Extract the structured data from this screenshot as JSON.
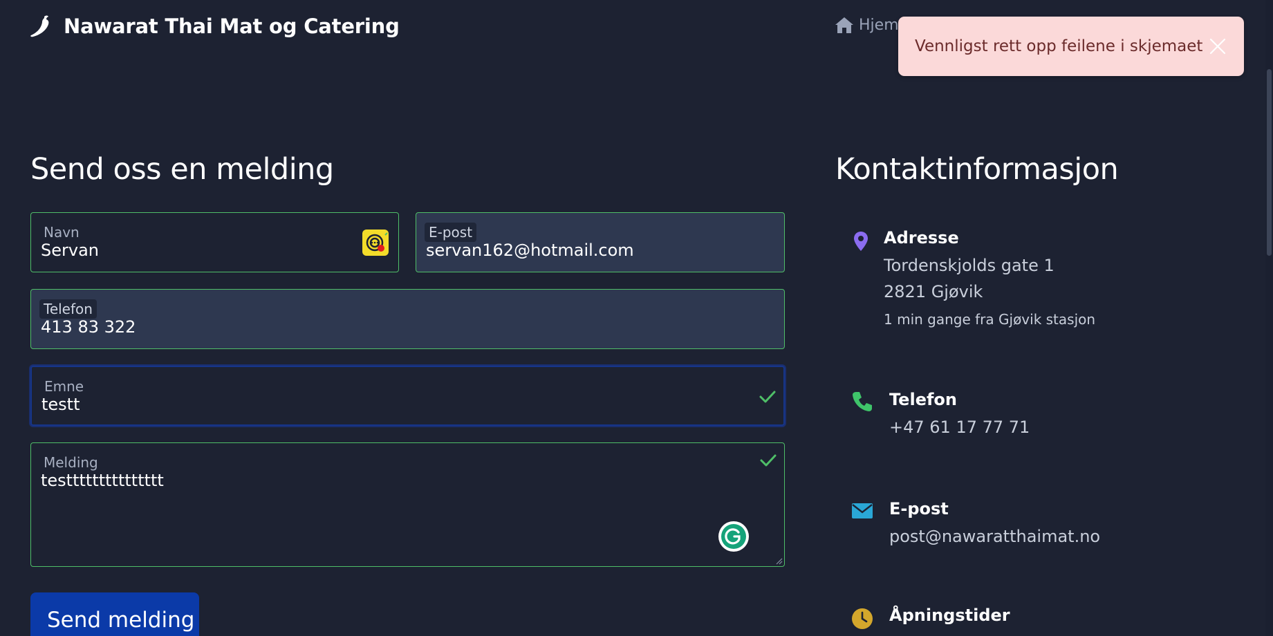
{
  "header": {
    "brand": "Nawarat Thai Mat og Catering",
    "nav_home": "Hjem"
  },
  "toast": {
    "message": "Vennligst rett opp feilene i skjemaet"
  },
  "form": {
    "heading": "Send oss en melding",
    "name": {
      "label": "Navn",
      "value": "Servan"
    },
    "email": {
      "label": "E-post",
      "value": "servan162@hotmail.com"
    },
    "phone": {
      "label": "Telefon",
      "value": "413 83 322"
    },
    "subject": {
      "label": "Emne",
      "value": "testt"
    },
    "message": {
      "label": "Melding",
      "value": "testtttttttttttttt"
    },
    "submit_label": "Send melding"
  },
  "contact": {
    "heading": "Kontaktinformasjon",
    "address": {
      "title": "Adresse",
      "street": "Tordenskjolds gate 1",
      "city": "2821 Gjøvik",
      "note": "1 min gange fra Gjøvik stasjon"
    },
    "phone": {
      "title": "Telefon",
      "value": "+47 61 17 77 71"
    },
    "email": {
      "title": "E-post",
      "value": "post@nawaratthaimat.no"
    },
    "hours": {
      "title": "Åpningstider"
    }
  },
  "colors": {
    "background": "#1d2232",
    "valid_border": "#4fbf68",
    "primary_button": "#0b3aa8",
    "toast_bg": "#fbd9d9",
    "icon_location": "#8b6cf0",
    "icon_phone": "#3fc46a",
    "icon_email": "#2aa7d6",
    "icon_clock": "#d4a72c"
  },
  "icons": {
    "brand": "chili-pepper-icon",
    "home": "home-icon",
    "close": "close-icon",
    "location": "map-pin-icon",
    "phone": "phone-icon",
    "email": "envelope-icon",
    "clock": "clock-icon"
  }
}
